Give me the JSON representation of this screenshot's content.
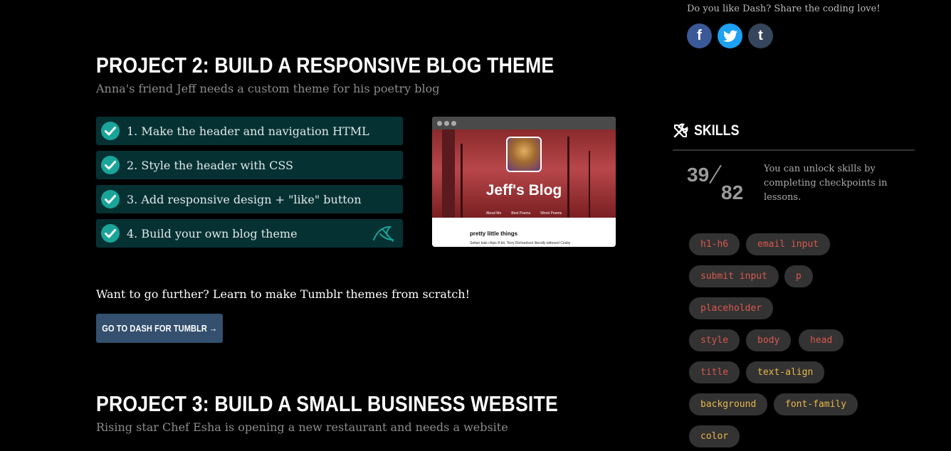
{
  "project2": {
    "title": "PROJECT 2: BUILD A RESPONSIVE BLOG THEME",
    "subtitle": "Anna's friend Jeff needs a custom theme for his poetry blog",
    "steps": [
      {
        "label": "1. Make the header and navigation HTML",
        "done": true
      },
      {
        "label": "2. Style the header with CSS",
        "done": true
      },
      {
        "label": "3. Add responsive design + \"like\" button",
        "done": true
      },
      {
        "label": "4. Build your own blog theme",
        "done": true
      }
    ],
    "preview": {
      "blog_name": "Jeff's Blog",
      "nav": [
        "About Me",
        "Best Poems",
        "Worst Poems"
      ],
      "post_title": "pretty little things",
      "post_text": "Seitan kale chips 8-bit, Terry Richardson literally tattooed Cosby"
    },
    "further_text": "Want to go further? Learn to make Tumblr themes from scratch!",
    "cta_label": "GO TO DASH FOR TUMBLR →"
  },
  "project3": {
    "title": "PROJECT 3: BUILD A SMALL BUSINESS WEBSITE",
    "subtitle": "Rising star Chef Esha is opening a new restaurant and needs a website"
  },
  "share": {
    "text": "Do you like Dash? Share the coding love!",
    "networks": [
      {
        "name": "facebook",
        "glyph": "f",
        "color": "#3b5998"
      },
      {
        "name": "twitter",
        "glyph": "t",
        "color": "#1da1f2"
      },
      {
        "name": "tumblr",
        "glyph": "t",
        "color": "#35465c"
      }
    ]
  },
  "skills": {
    "title": "SKILLS",
    "unlocked": "39",
    "total": "82",
    "description": "You can unlock skills by completing checkpoints in lessons.",
    "tags": [
      {
        "label": "h1-h6",
        "state": "locked"
      },
      {
        "label": "email input",
        "state": "locked"
      },
      {
        "label": "submit input",
        "state": "locked"
      },
      {
        "label": "p",
        "state": "locked"
      },
      {
        "label": "placeholder",
        "state": "locked"
      },
      {
        "label": "style",
        "state": "locked"
      },
      {
        "label": "body",
        "state": "locked"
      },
      {
        "label": "head",
        "state": "locked"
      },
      {
        "label": "title",
        "state": "locked"
      },
      {
        "label": "text-align",
        "state": "unlocked"
      },
      {
        "label": "background",
        "state": "unlocked"
      },
      {
        "label": "font-family",
        "state": "unlocked"
      },
      {
        "label": "color",
        "state": "unlocked"
      }
    ]
  },
  "colors": {
    "step_bg": "#063133",
    "check": "#19a59a",
    "cta_bg": "#34506e",
    "tag_locked_text": "#d9584e",
    "tag_unlocked_text": "#e8b84a"
  }
}
